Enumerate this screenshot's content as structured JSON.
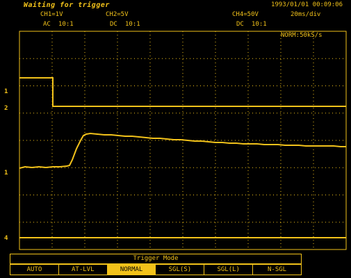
{
  "status": "Waiting for trigger",
  "datetime": "1993/01/01  00:09:06",
  "channels": {
    "ch1": {
      "label": "CH1=1V",
      "coupling": "AC",
      "probe": "10:1"
    },
    "ch2": {
      "label": "CH2=5V",
      "coupling": "DC",
      "probe": "10:1"
    },
    "ch4": {
      "label": "CH4=50V",
      "coupling": "DC",
      "probe": "10:1"
    }
  },
  "timebase": "20ms/div",
  "acquisition": "NORM:50kS/s",
  "markers": {
    "m1": "1",
    "m2": "2",
    "m3": "1",
    "m4": "4"
  },
  "trigger_menu": {
    "title": "Trigger Mode",
    "options": [
      "AUTO",
      "AT-LVL",
      "NORMAL",
      "SGL(S)",
      "SGL(L)",
      "N-SGL"
    ],
    "selected": "NORMAL"
  },
  "colors": {
    "trace": "#f2c21a",
    "background": "#000000",
    "grid": "#f2c21a"
  }
}
